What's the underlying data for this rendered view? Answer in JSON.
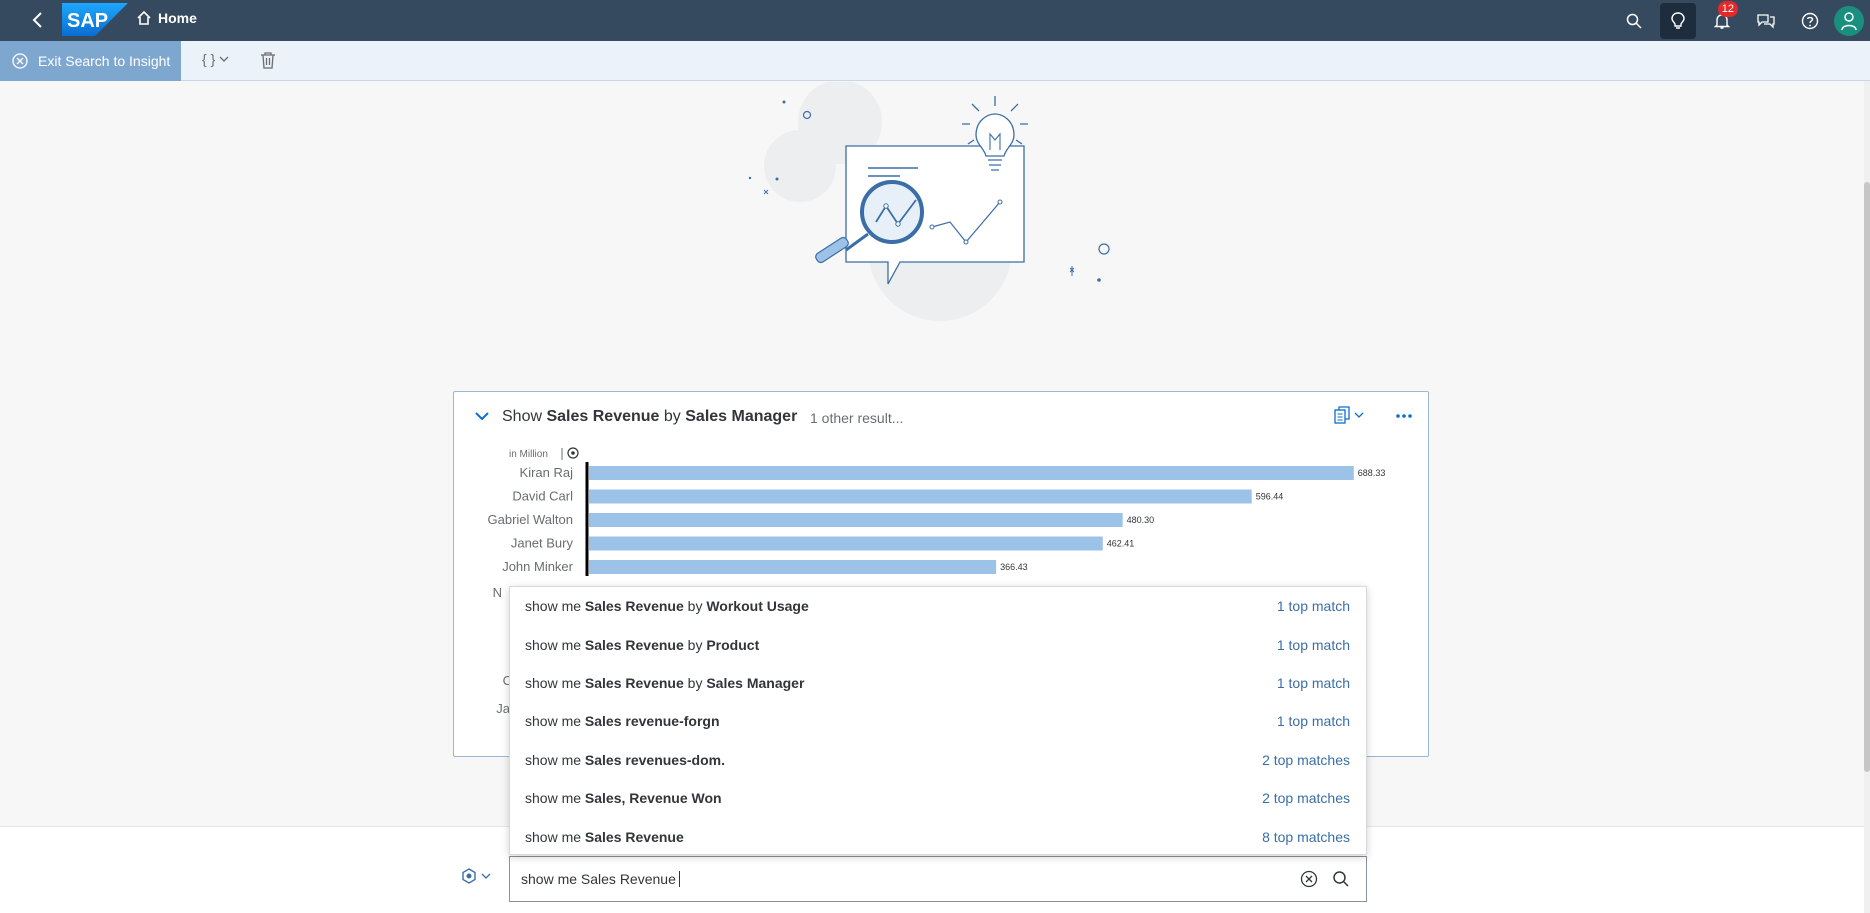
{
  "shell": {
    "logo_text": "SAP",
    "home_label": "Home",
    "notification_count": "12",
    "accent_color": "#354a5f"
  },
  "toolbar": {
    "exit_label": "Exit Search to Insight",
    "code_label": "{ }"
  },
  "card": {
    "title_prefix": "Show",
    "title_measure": "Sales Revenue",
    "title_by": "by",
    "title_dimension": "Sales Manager",
    "other_results": "1 other result...",
    "unit_label": "in Million"
  },
  "chart_data": {
    "type": "bar",
    "orientation": "horizontal",
    "categories": [
      "Kiran Raj",
      "David Carl",
      "Gabriel Walton",
      "Janet Bury",
      "John Minker"
    ],
    "hidden_category_fragments": [
      "N",
      "C",
      "Ja"
    ],
    "values": [
      688.33,
      596.44,
      480.3,
      462.41,
      366.43
    ],
    "value_labels": [
      "688.33",
      "596.44",
      "480.30",
      "462.41",
      "366.43"
    ],
    "xlim": [
      0,
      720
    ],
    "bar_color": "#9cc2e8",
    "legend": "none",
    "grid": false
  },
  "suggestions": [
    {
      "prefix": "show me",
      "bold1": "Sales Revenue",
      "mid": "by",
      "bold2": "Workout Usage",
      "matches": "1 top match"
    },
    {
      "prefix": "show me",
      "bold1": "Sales Revenue",
      "mid": "by",
      "bold2": "Product",
      "matches": "1 top match"
    },
    {
      "prefix": "show me",
      "bold1": "Sales Revenue",
      "mid": "by",
      "bold2": "Sales Manager",
      "matches": "1 top match"
    },
    {
      "prefix": "show me",
      "bold1": "Sales revenue-forgn",
      "mid": "",
      "bold2": "",
      "matches": "1 top match"
    },
    {
      "prefix": "show me",
      "bold1": "Sales revenues-dom.",
      "mid": "",
      "bold2": "",
      "matches": "2 top matches"
    },
    {
      "prefix": "show me",
      "bold1": "Sales, Revenue Won",
      "mid": "",
      "bold2": "",
      "matches": "2 top matches"
    },
    {
      "prefix": "show me",
      "bold1": "Sales Revenue",
      "mid": "",
      "bold2": "",
      "matches": "8 top matches"
    }
  ],
  "search": {
    "value": "show me Sales Revenue"
  }
}
